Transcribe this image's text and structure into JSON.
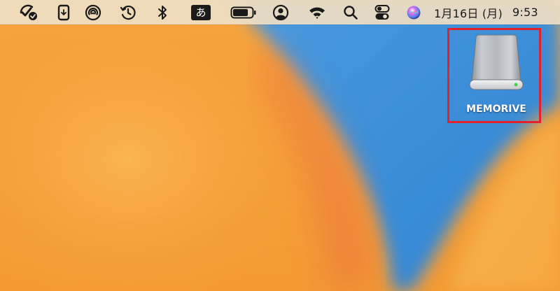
{
  "menubar": {
    "status_icons": [
      "checklist-check-icon",
      "phone-mirroring-icon",
      "airdrop-icon",
      "time-machine-icon",
      "bluetooth-icon",
      "input-method-icon",
      "battery-icon",
      "user-account-icon",
      "wifi-icon",
      "spotlight-search-icon",
      "control-center-icon",
      "siri-icon"
    ],
    "input_method_label": "あ",
    "date": "1月16日 (月)",
    "time": "9:53"
  },
  "desktop": {
    "drive_label": "MEMORIVE",
    "drive_icon": "external-drive-icon",
    "highlight_color": "#e3202c"
  },
  "colors": {
    "wallpaper_orange": "#f5a53a",
    "wallpaper_blue": "#3b8fd8",
    "menubar_bg": "#eedec4",
    "highlight": "#e3202c"
  }
}
